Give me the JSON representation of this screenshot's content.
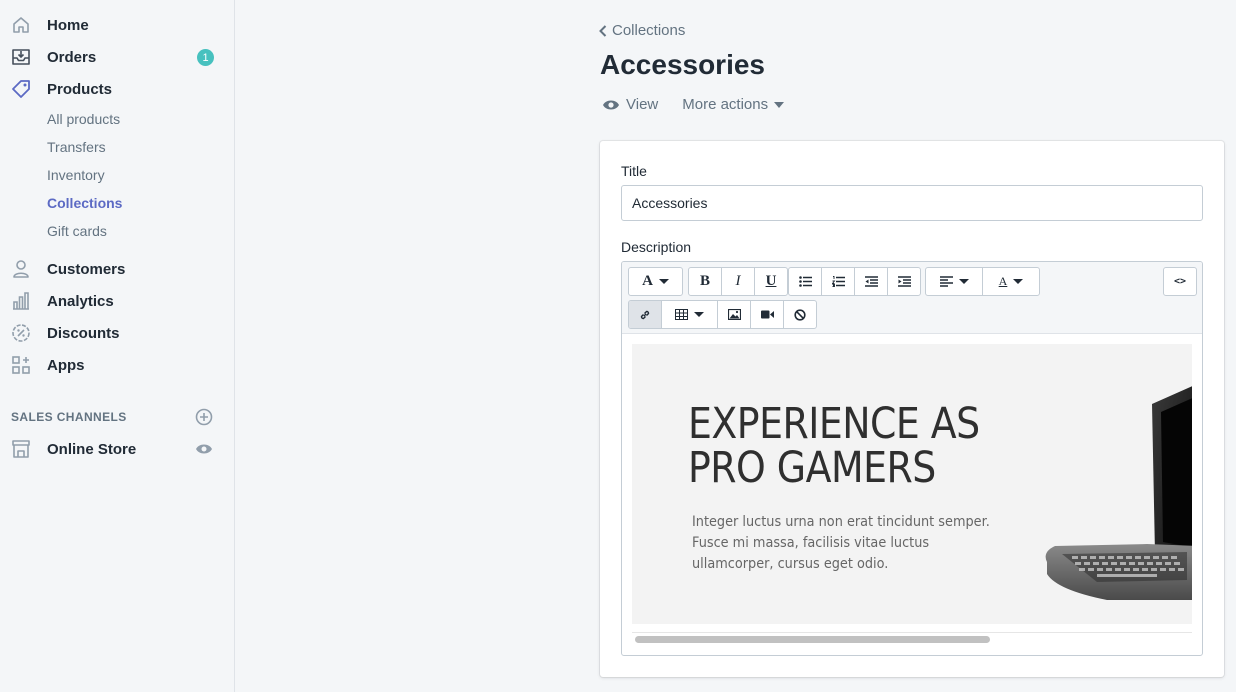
{
  "sidebar": {
    "items": [
      {
        "label": "Home",
        "icon": "home-icon"
      },
      {
        "label": "Orders",
        "icon": "orders-icon",
        "badge": "1"
      },
      {
        "label": "Products",
        "icon": "tag-icon"
      }
    ],
    "products_sub": [
      "All products",
      "Transfers",
      "Inventory",
      "Collections",
      "Gift cards"
    ],
    "active_sub": "Collections",
    "items2": [
      {
        "label": "Customers",
        "icon": "person-icon"
      },
      {
        "label": "Analytics",
        "icon": "bar-chart-icon"
      },
      {
        "label": "Discounts",
        "icon": "discount-icon"
      },
      {
        "label": "Apps",
        "icon": "apps-icon"
      }
    ],
    "sales_channels_title": "SALES CHANNELS",
    "online_store": "Online Store"
  },
  "header": {
    "breadcrumb": "Collections",
    "title": "Accessories",
    "view_label": "View",
    "more_actions_label": "More actions"
  },
  "form": {
    "title_label": "Title",
    "title_value": "Accessories",
    "description_label": "Description"
  },
  "toolbar": {
    "font_glyph": "A",
    "bold_glyph": "B",
    "italic_glyph": "I",
    "underline_glyph": "U",
    "color_glyph": "A",
    "html_glyph": "<>"
  },
  "editor_content": {
    "heading_line1": "EXPERIENCE AS",
    "heading_line2": "PRO GAMERS",
    "body": "Integer luctus urna non erat tincidunt semper. Fusce mi massa, facilisis vitae luctus ullamcorper, cursus eget odio."
  },
  "colors": {
    "accent": "#5c6ac4",
    "badge": "#47c1bf",
    "text": "#212b36",
    "muted": "#637381",
    "background": "#f4f6f8"
  }
}
